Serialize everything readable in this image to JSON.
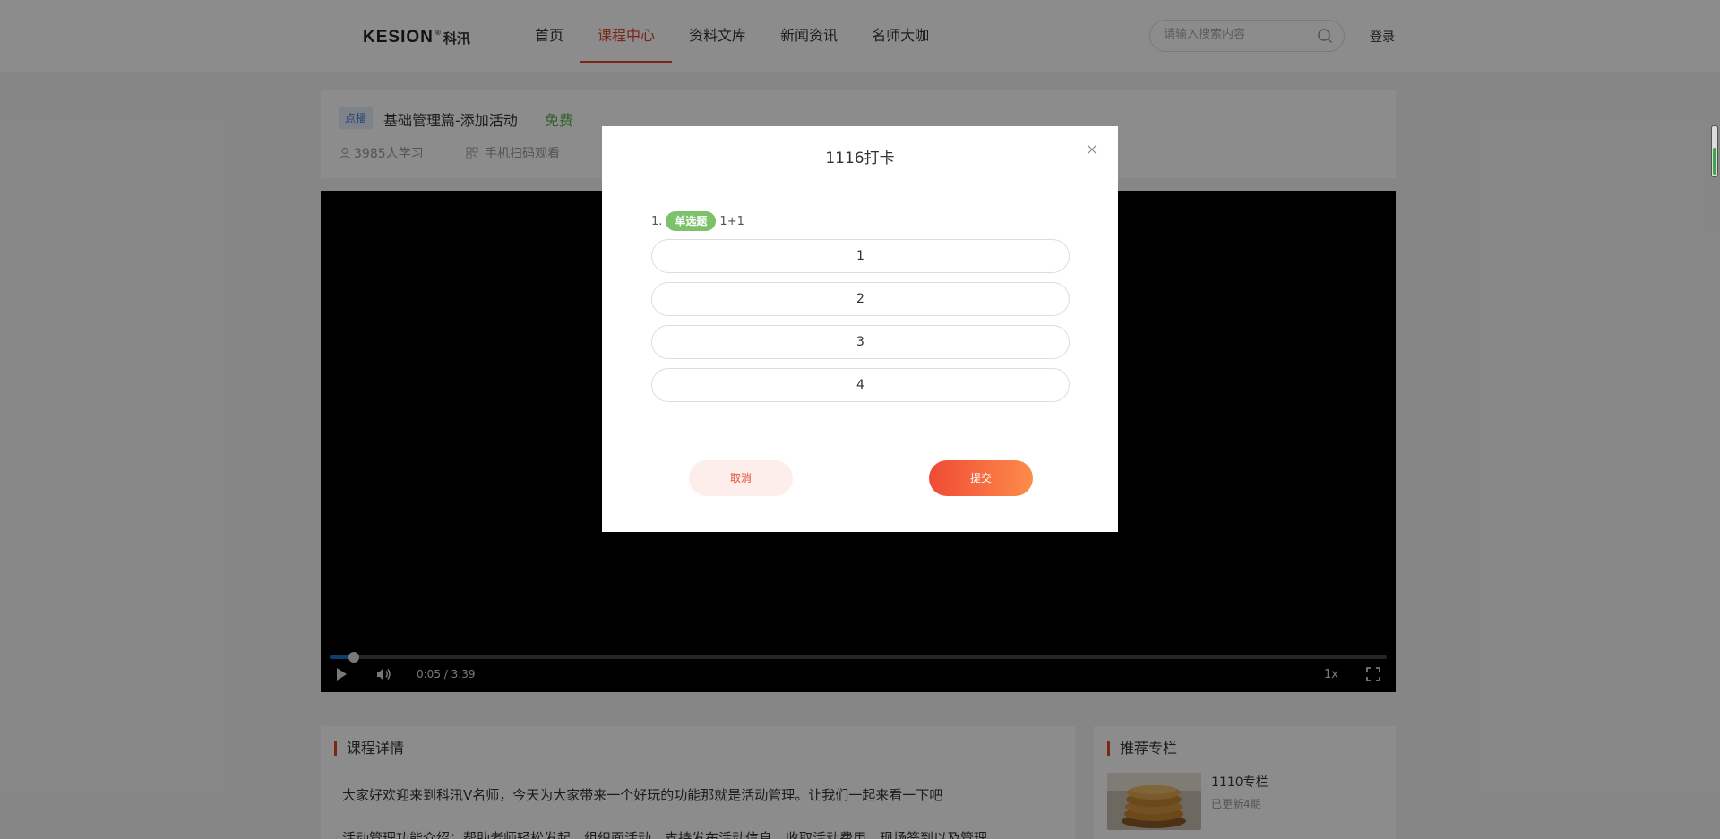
{
  "header": {
    "logo_en": "KESION",
    "logo_reg": "®",
    "logo_cn": "科汛",
    "nav": [
      {
        "label": "首页",
        "active": false
      },
      {
        "label": "课程中心",
        "active": true
      },
      {
        "label": "资料文库",
        "active": false
      },
      {
        "label": "新闻资讯",
        "active": false
      },
      {
        "label": "名师大咖",
        "active": false
      }
    ],
    "search_placeholder": "请输入搜索内容",
    "login_label": "登录"
  },
  "course": {
    "tag": "点播",
    "title": "基础管理篇-添加活动",
    "price": "免费",
    "learners": "3985人学习",
    "mobile_watch": "手机扫码观看"
  },
  "player": {
    "time": "0:05 / 3:39",
    "speed": "1x",
    "progress_fraction": 0.023
  },
  "detail": {
    "title": "课程详情",
    "p1": "大家好欢迎来到科汛V名师，今天为大家带来一个好玩的功能那就是活动管理。让我们一起来看一下吧",
    "p2": "活动管理功能介绍：帮助老师轻松发起、组织面活动，支持发布活动信息、收取活动费用、现场签到以及管理"
  },
  "recommend": {
    "title": "推荐专栏",
    "item_name": "1110专栏",
    "item_update": "已更新4期"
  },
  "modal": {
    "title": "1116打卡",
    "question_number": "1.",
    "question_type": "单选题",
    "question_text": "1+1",
    "options": [
      "1",
      "2",
      "3",
      "4"
    ],
    "cancel_label": "取消",
    "submit_label": "提交"
  },
  "colors": {
    "accent": "#e0452b",
    "free_green": "#58b24a",
    "type_badge": "#7cc26b",
    "submit_gradient_start": "#ef4b35",
    "submit_gradient_end": "#fd8c4a"
  }
}
